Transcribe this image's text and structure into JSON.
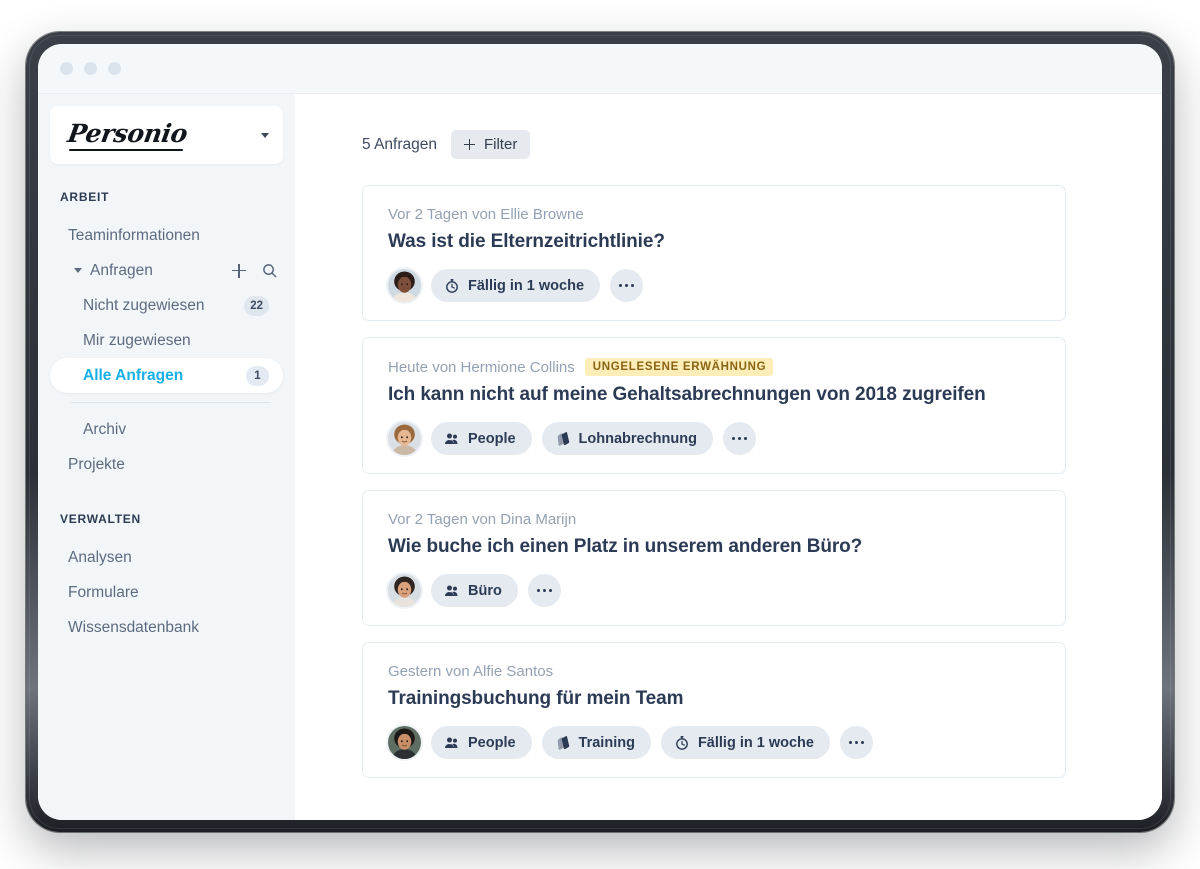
{
  "window": {
    "dots": [
      "dot-red",
      "dot-yellow",
      "dot-green"
    ]
  },
  "sidebar": {
    "logo": "Personio",
    "logo_caret": "chevron-down-icon",
    "sections": [
      {
        "title": "ARBEIT",
        "items": [
          {
            "label": "Teaminformationen",
            "type": "item"
          },
          {
            "label": "Anfragen",
            "type": "group",
            "actions": [
              "plus-icon",
              "search-icon"
            ],
            "children": [
              {
                "label": "Nicht zugewiesen",
                "badge": "22",
                "active": false
              },
              {
                "label": "Mir zugewiesen",
                "badge": "",
                "active": false
              },
              {
                "label": "Alle Anfragen",
                "badge": "1",
                "active": true
              }
            ],
            "after_divider": [
              {
                "label": "Archiv"
              }
            ]
          },
          {
            "label": "Projekte",
            "type": "item"
          }
        ]
      },
      {
        "title": "VERWALTEN",
        "items": [
          {
            "label": "Analysen",
            "type": "item"
          },
          {
            "label": "Formulare",
            "type": "item"
          },
          {
            "label": "Wissensdatenbank",
            "type": "item"
          }
        ]
      }
    ]
  },
  "main": {
    "count_label": "5 Anfragen",
    "filter_label": "Filter",
    "requests": [
      {
        "meta": "Vor 2 Tagen von Ellie Browne",
        "badge": "",
        "title": "Was ist die Elternzeitrichtlinie?",
        "avatar": "avatar-ellie-browne",
        "tags": [
          {
            "icon": "stopwatch-icon",
            "label": "Fällig in 1 woche"
          }
        ],
        "more": "more-options-icon"
      },
      {
        "meta": "Heute von Hermione Collins",
        "badge": "UNGELESENE ERWÄHNUNG",
        "title": "Ich kann nicht auf meine Gehaltsabrechnungen von 2018 zugreifen",
        "avatar": "avatar-hermione-collins",
        "tags": [
          {
            "icon": "people-icon",
            "label": "People"
          },
          {
            "icon": "tag-stack-icon",
            "label": "Lohnabrechnung"
          }
        ],
        "more": "more-options-icon"
      },
      {
        "meta": "Vor 2 Tagen von Dina Marijn",
        "badge": "",
        "title": "Wie buche ich einen Platz in unserem anderen Büro?",
        "avatar": "avatar-dina-marijn",
        "tags": [
          {
            "icon": "people-icon",
            "label": "Büro"
          }
        ],
        "more": "more-options-icon"
      },
      {
        "meta": "Gestern von Alfie Santos",
        "badge": "",
        "title": "Trainingsbuchung für mein Team",
        "avatar": "avatar-alfie-santos",
        "tags": [
          {
            "icon": "people-icon",
            "label": "People"
          },
          {
            "icon": "tag-stack-icon",
            "label": "Training"
          },
          {
            "icon": "stopwatch-icon",
            "label": "Fällig in 1 woche"
          }
        ],
        "more": "more-options-icon"
      }
    ]
  },
  "colors": {
    "accent": "#19b0e8",
    "sidebar_bg": "#f2f6f9",
    "text_dark": "#2c3b55",
    "text_muted": "#93a1b4",
    "tag_bg": "#e4eaf0",
    "badge_bg": "#fdeeb9",
    "badge_text": "#8a6412"
  }
}
